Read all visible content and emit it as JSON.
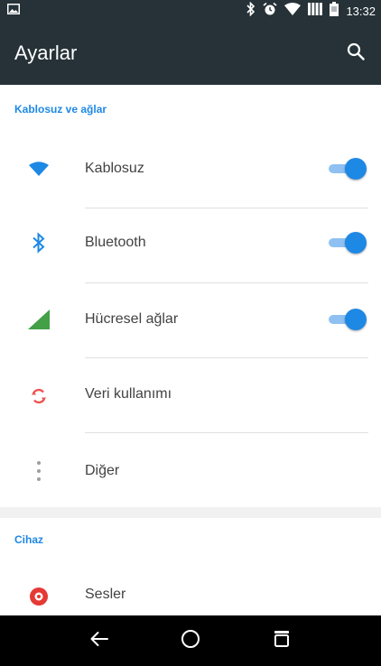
{
  "status_bar": {
    "time": "13:32",
    "icons": [
      "image-notification-icon",
      "bluetooth-icon",
      "alarm-icon",
      "wifi-icon",
      "signal-icon",
      "battery-icon"
    ]
  },
  "app_bar": {
    "title": "Ayarlar",
    "search_icon": "search-icon"
  },
  "sections": [
    {
      "header": "Kablosuz ve ağlar",
      "items": [
        {
          "label": "Kablosuz",
          "icon": "wifi-icon",
          "toggle": true,
          "icon_color": "#1e88e5"
        },
        {
          "label": "Bluetooth",
          "icon": "bluetooth-icon",
          "toggle": true,
          "icon_color": "#1e88e5"
        },
        {
          "label": "Hücresel ağlar",
          "icon": "cellular-icon",
          "toggle": true,
          "icon_color": "#43a047"
        },
        {
          "label": "Veri kullanımı",
          "icon": "data-usage-icon",
          "icon_color": "#ef5350"
        },
        {
          "label": "Diğer",
          "icon": "more-icon",
          "icon_color": "#9e9e9e"
        }
      ]
    },
    {
      "header": "Cihaz",
      "items": [
        {
          "label": "Sesler",
          "icon": "sound-icon",
          "icon_color": "#e53935"
        }
      ]
    }
  ],
  "nav_bar": {
    "icons": [
      "back-icon",
      "home-icon",
      "recents-icon"
    ]
  },
  "colors": {
    "accent": "#1e88e5",
    "app_bar": "#263238",
    "nav_bar": "#000000"
  }
}
